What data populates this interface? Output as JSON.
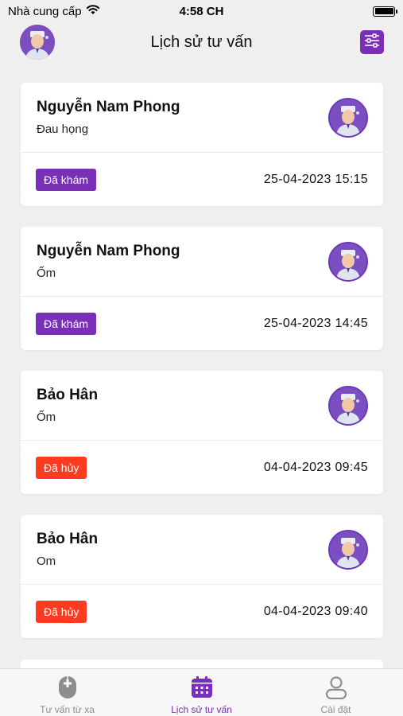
{
  "status_bar": {
    "carrier": "Nhà cung cấp",
    "time": "4:58 CH"
  },
  "header": {
    "title": "Lịch sử tư vấn"
  },
  "consultations": [
    {
      "name": "Nguyễn Nam Phong",
      "reason": "Đau họng",
      "status": "Đã khám",
      "status_type": "done",
      "datetime": "25-04-2023 15:15"
    },
    {
      "name": "Nguyễn Nam Phong",
      "reason": "Ốm",
      "status": "Đã khám",
      "status_type": "done",
      "datetime": "25-04-2023 14:45"
    },
    {
      "name": "Bảo Hân",
      "reason": "Ốm",
      "status": "Đã hủy",
      "status_type": "cancelled",
      "datetime": "04-04-2023 09:45"
    },
    {
      "name": "Bảo Hân",
      "reason": "Om",
      "status": "Đã hủy",
      "status_type": "cancelled",
      "datetime": "04-04-2023 09:40"
    }
  ],
  "tabs": [
    {
      "label": "Tư vấn từ xa",
      "icon": "mouse-plus-icon",
      "active": false
    },
    {
      "label": "Lịch sử tư vấn",
      "icon": "calendar-icon",
      "active": true
    },
    {
      "label": "Cài đặt",
      "icon": "user-icon",
      "active": false
    }
  ],
  "colors": {
    "accent": "#7a2fb8",
    "cancelled": "#ff3b1f",
    "background": "#efeff0"
  }
}
